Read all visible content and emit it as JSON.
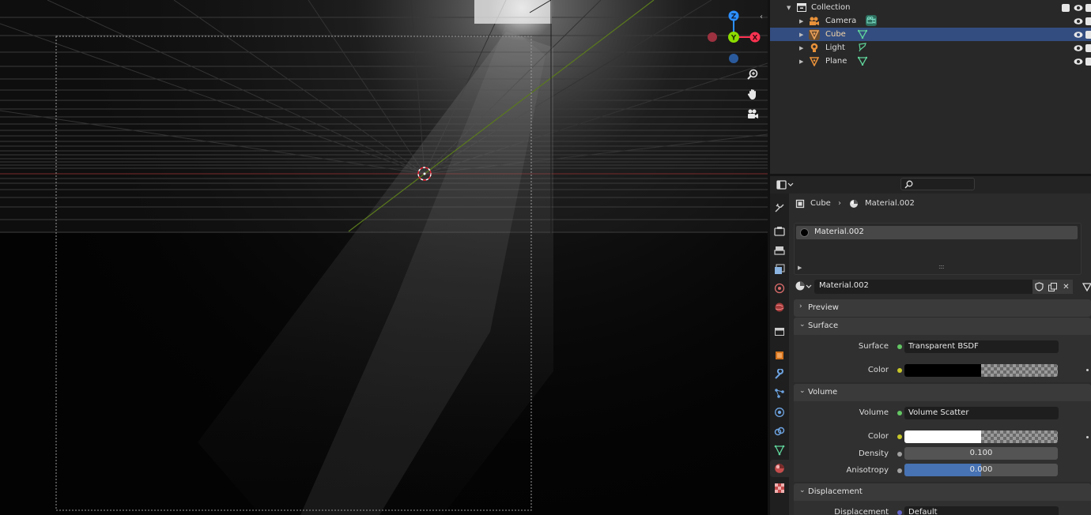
{
  "outliner": {
    "rows": [
      {
        "label": "Collection",
        "selected": false
      },
      {
        "label": "Camera",
        "selected": false
      },
      {
        "label": "Cube",
        "selected": true
      },
      {
        "label": "Light",
        "selected": false
      },
      {
        "label": "Plane",
        "selected": false
      }
    ]
  },
  "properties": {
    "breadcrumb": {
      "object": "Cube",
      "material": "Material.002"
    },
    "slots": [
      {
        "label": "Material.002"
      }
    ],
    "material_name": "Material.002",
    "panels": {
      "preview": {
        "title": "Preview"
      },
      "surface": {
        "title": "Surface",
        "surface_label": "Surface",
        "surface_value": "Transparent BSDF",
        "color_label": "Color",
        "color_value": "#000000"
      },
      "volume": {
        "title": "Volume",
        "volume_label": "Volume",
        "volume_value": "Volume Scatter",
        "color_label": "Color",
        "color_value": "#ffffff",
        "density_label": "Density",
        "density_value": "0.100",
        "anisotropy_label": "Anisotropy",
        "anisotropy_value": "0.000",
        "anisotropy_fraction": 0.5
      },
      "displacement": {
        "title": "Displacement",
        "displacement_label": "Displacement",
        "displacement_value": "Default"
      }
    }
  },
  "gizmo": {
    "z": "Z",
    "y": "Y",
    "x": "X"
  },
  "colors": {
    "selection": "#334d80",
    "accent_blue": "#4772b3",
    "socket_green": "#63c763",
    "socket_yellow": "#c7c729",
    "socket_grey": "#a1a1a1",
    "socket_purple": "#6363c7",
    "axis_x": "#ff3352",
    "axis_y": "#8bdc00",
    "axis_z": "#2c8fff"
  },
  "icons": {
    "viewport_nav": [
      "zoom-icon",
      "hand-pan-icon",
      "camera-view-icon"
    ],
    "tabs": [
      "tool-icon",
      "render-icon",
      "output-icon",
      "view-layer-icon",
      "scene-icon",
      "world-icon",
      "collection-icon",
      "object-icon",
      "modifier-icon",
      "particles-icon",
      "physics-icon",
      "constraints-icon",
      "object-data-icon",
      "material-icon",
      "texture-icon"
    ]
  }
}
